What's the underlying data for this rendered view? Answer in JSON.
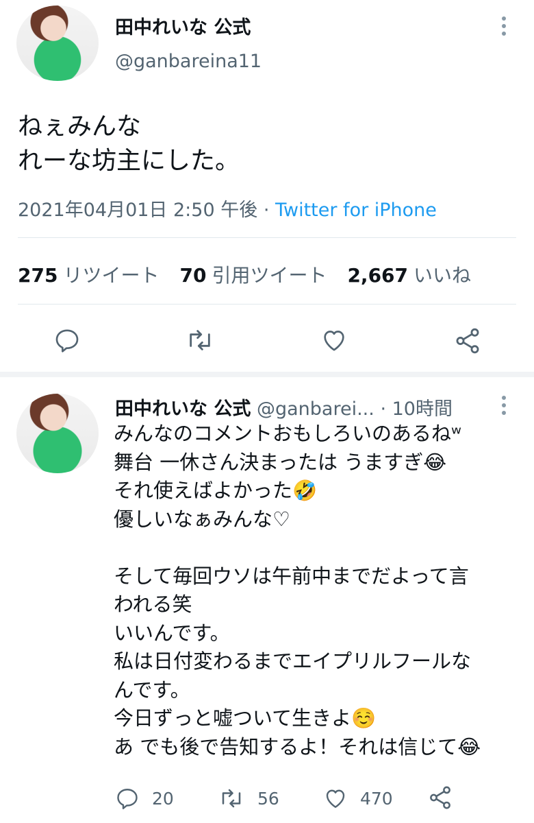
{
  "tweet": {
    "display_name": "田中れいな 公式",
    "handle": "@ganbareina11",
    "text_lines": [
      "ねぇみんな",
      "れーな坊主にした。"
    ],
    "timestamp": "2021年04月01日 2:50 午後",
    "separator": " · ",
    "source": "Twitter for iPhone",
    "stats": {
      "retweets_count": "275",
      "retweets_label": "リツイート",
      "quotes_count": "70",
      "quotes_label": "引用ツイート",
      "likes_count": "2,667",
      "likes_label": "いいね"
    }
  },
  "reply": {
    "display_name": "田中れいな 公式",
    "handle": "@ganbarei...",
    "time": "· 10時間",
    "text": "みんなのコメントおもしろいのあるねʷ\n舞台 一休さん決まったは うますぎ😂\nそれ使えばよかった🤣\n優しいなぁみんな♡\n\nそして毎回ウソは午前中までだよって言\nわれる笑\nいいんです。\n私は日付変わるまでエイプリルフールな\nんです。\n今日ずっと嘘ついて生きよ☺️\nあ でも後で告知するよ！それは信じて😂",
    "counts": {
      "replies": "20",
      "retweets": "56",
      "likes": "470"
    }
  },
  "icons": [
    "reply-icon",
    "retweet-icon",
    "like-icon",
    "share-icon",
    "more-icon"
  ],
  "colors": {
    "link": "#1d9bf0",
    "secondary_text": "#536471",
    "icon": "#536471"
  }
}
